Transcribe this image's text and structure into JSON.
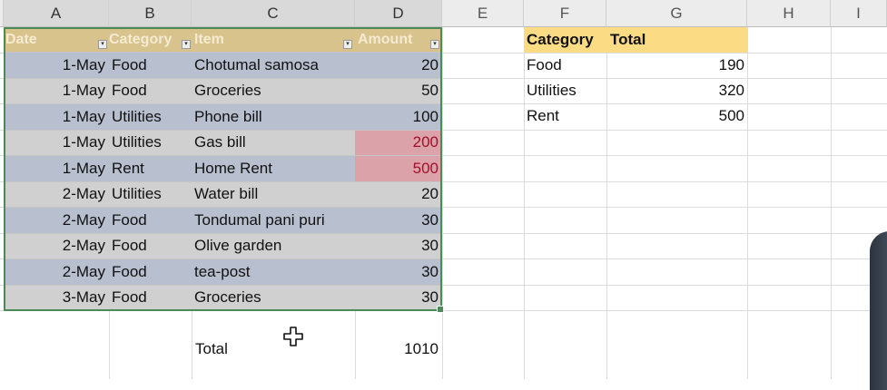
{
  "columns": [
    "A",
    "B",
    "C",
    "D",
    "E",
    "F",
    "G",
    "H",
    "I"
  ],
  "table": {
    "headers": [
      "Date",
      "Category",
      "Item",
      "Amount"
    ],
    "rows": [
      {
        "date": "1-May",
        "category": "Food",
        "item": "Chotumal samosa",
        "amount": "20"
      },
      {
        "date": "1-May",
        "category": "Food",
        "item": "Groceries",
        "amount": "50"
      },
      {
        "date": "1-May",
        "category": "Utilities",
        "item": "Phone bill",
        "amount": "100"
      },
      {
        "date": "1-May",
        "category": "Utilities",
        "item": "Gas bill",
        "amount": "200"
      },
      {
        "date": "1-May",
        "category": "Rent",
        "item": "Home Rent",
        "amount": "500"
      },
      {
        "date": "2-May",
        "category": "Utilities",
        "item": "Water bill",
        "amount": "20"
      },
      {
        "date": "2-May",
        "category": "Food",
        "item": "Tondumal pani puri",
        "amount": "30"
      },
      {
        "date": "2-May",
        "category": "Food",
        "item": "Olive garden",
        "amount": "30"
      },
      {
        "date": "2-May",
        "category": "Food",
        "item": "tea-post",
        "amount": "30"
      },
      {
        "date": "3-May",
        "category": "Food",
        "item": "Groceries",
        "amount": "30"
      }
    ],
    "total_label": "Total",
    "total_value": "1010"
  },
  "summary": {
    "headers": [
      "Category",
      "Total"
    ],
    "rows": [
      {
        "category": "Food",
        "total": "190"
      },
      {
        "category": "Utilities",
        "total": "320"
      },
      {
        "category": "Rent",
        "total": "500"
      }
    ]
  },
  "colors": {
    "header_band": "#d8c38c",
    "row_band_a": "#b8bfcf",
    "row_band_b": "#d0d0d0",
    "highlight": "#dca2aa",
    "summary_header": "#fbdc85",
    "selection": "#4d8a5a"
  },
  "icons": [
    "filter-dropdown-icon",
    "move-cursor-icon"
  ]
}
